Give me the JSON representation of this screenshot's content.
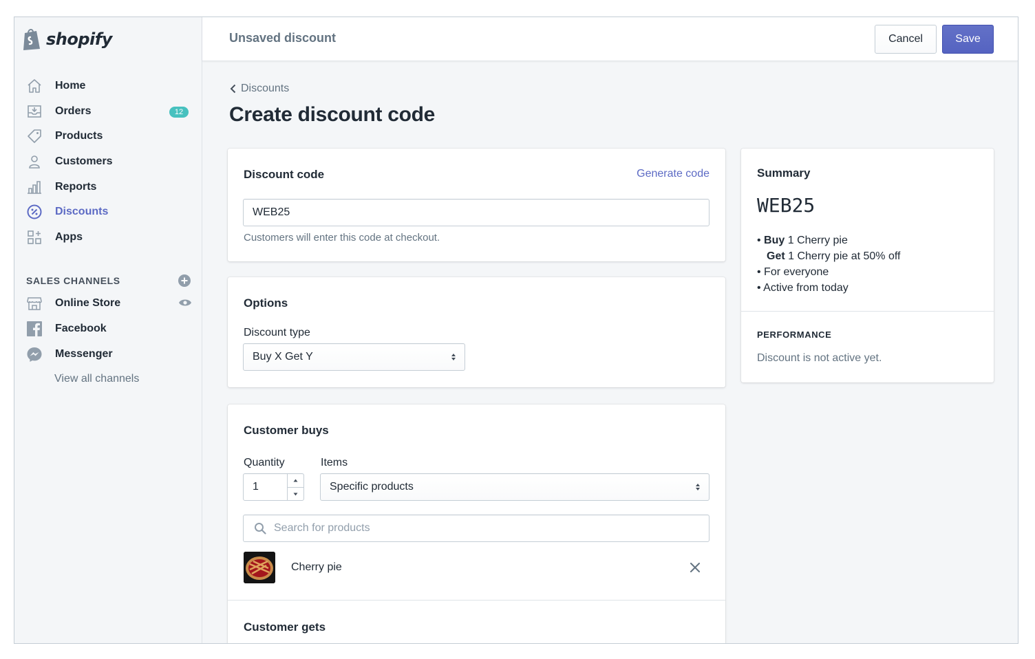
{
  "brand": {
    "name": "shopify",
    "accent": "#5c6ac4",
    "logo_green": "#95bf47"
  },
  "sidebar": {
    "items": [
      {
        "label": "Home",
        "icon": "home-icon"
      },
      {
        "label": "Orders",
        "icon": "orders-icon",
        "badge": "12"
      },
      {
        "label": "Products",
        "icon": "tag-icon"
      },
      {
        "label": "Customers",
        "icon": "person-icon"
      },
      {
        "label": "Reports",
        "icon": "bar-chart-icon"
      },
      {
        "label": "Discounts",
        "icon": "discount-icon",
        "active": true
      },
      {
        "label": "Apps",
        "icon": "apps-icon"
      }
    ],
    "sales_channels_heading": "SALES CHANNELS",
    "channels": [
      {
        "label": "Online Store",
        "icon": "store-icon"
      },
      {
        "label": "Facebook",
        "icon": "facebook-icon"
      },
      {
        "label": "Messenger",
        "icon": "messenger-icon"
      }
    ],
    "view_all": "View all channels"
  },
  "topbar": {
    "title": "Unsaved discount",
    "cancel_label": "Cancel",
    "save_label": "Save"
  },
  "main": {
    "breadcrumb": "Discounts",
    "page_title": "Create discount code",
    "discount_code_card": {
      "title": "Discount code",
      "generate_link": "Generate code",
      "code_value": "WEB25",
      "help": "Customers will enter this code at checkout."
    },
    "options_card": {
      "title": "Options",
      "discount_type_label": "Discount type",
      "discount_type_value": "Buy X Get Y"
    },
    "customer_buys_card": {
      "title": "Customer buys",
      "quantity_label": "Quantity",
      "quantity_value": "1",
      "items_label": "Items",
      "items_value": "Specific products",
      "search_placeholder": "Search for products",
      "product_name": "Cherry pie",
      "gets_title": "Customer gets"
    }
  },
  "summary": {
    "title": "Summary",
    "code": "WEB25",
    "buy_bold": "Buy",
    "buy_text": "1 Cherry pie",
    "get_bold": "Get",
    "get_text": "1 Cherry pie at 50% off",
    "line3": "For everyone",
    "line4": "Active from today",
    "performance_heading": "PERFORMANCE",
    "performance_text": "Discount is not active yet."
  }
}
